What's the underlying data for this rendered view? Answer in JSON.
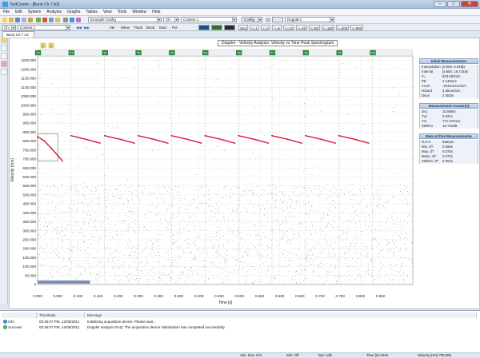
{
  "window": {
    "title": "TestCenter - [Burst Ch 7 A2]"
  },
  "menu": [
    "File",
    "Edit",
    "System",
    "Analysis",
    "Graphs",
    "Tables",
    "View",
    "Tools",
    "Window",
    "Help"
  ],
  "toolbar": {
    "config_combo": "Example Config",
    "ch_label": "Ch:",
    "context_combo": "Context 1",
    "config_btn": "Config",
    "doppler_combo": "Doppler1",
    "ch_combo2": "Ch:",
    "context_combo2": "Context 1",
    "row2_buttons": [
      "Vel",
      "Meas",
      "Track",
      "Burst",
      "Mod",
      "Pol"
    ],
    "zoom_buttons": [
      "Seq",
      "<=1",
      "<=2",
      "<=5",
      "<=10",
      "<=20",
      "<=50",
      "<=100",
      "<=200",
      "<=500"
    ]
  },
  "doc_tab": "Burst Ch 7 A2",
  "chart_data": {
    "type": "scatter",
    "title": "Doppler - Velocity Analysis: Velocity vs Time Peak Spectrogram",
    "xlabel": "Time [s]",
    "ylabel": "Velocity [m/s]",
    "xlim": [
      0.0,
      0.93
    ],
    "ylim": [
      0,
      1275
    ],
    "x_ticks": [
      "0.000",
      "0.050",
      "0.100",
      "0.150",
      "0.200",
      "0.250",
      "0.300",
      "0.350",
      "0.400",
      "0.450",
      "0.500",
      "0.550",
      "0.600",
      "0.650",
      "0.700",
      "0.750",
      "0.800",
      "0.850"
    ],
    "x_tick_values": [
      0,
      0.05,
      0.1,
      0.15,
      0.2,
      0.25,
      0.3,
      0.35,
      0.4,
      0.45,
      0.5,
      0.55,
      0.6,
      0.65,
      0.7,
      0.75,
      0.8,
      0.85
    ],
    "y_ticks": [
      "0",
      "50.000",
      "100.000",
      "150.000",
      "200.000",
      "250.000",
      "300.000",
      "350.000",
      "400.000",
      "450.000",
      "500.000",
      "550.000",
      "600.000",
      "650.000",
      "700.000",
      "750.000",
      "800.000",
      "850.000",
      "900.000",
      "950.000",
      "1000.000",
      "1050.000",
      "1100.000",
      "1150.000",
      "1200.000",
      "1250.000"
    ],
    "y_tick_values": [
      0,
      50,
      100,
      150,
      200,
      250,
      300,
      350,
      400,
      450,
      500,
      550,
      600,
      650,
      700,
      750,
      800,
      850,
      900,
      950,
      1000,
      1050,
      1100,
      1150,
      1200,
      1250
    ],
    "markers": [
      "T0",
      "T1",
      "T2",
      "T3",
      "T4",
      "T5",
      "T6",
      "T7",
      "T8",
      "T9",
      "T10"
    ],
    "marker_x": [
      0.0,
      0.083,
      0.166,
      0.249,
      0.332,
      0.415,
      0.498,
      0.581,
      0.664,
      0.747,
      0.83
    ],
    "cursors": [
      "F",
      "C"
    ],
    "grid": true,
    "bursts": [
      {
        "x": [
          0.0,
          0.017,
          0.034,
          0.05,
          0.062
        ],
        "y": [
          825,
          800,
          760,
          720,
          688
        ],
        "color": "#d81c3c"
      },
      {
        "x": [
          0.083,
          0.12,
          0.155
        ],
        "y": [
          830,
          810,
          788
        ],
        "color": "#d81c3c"
      },
      {
        "x": [
          0.166,
          0.205,
          0.24
        ],
        "y": [
          830,
          810,
          788
        ],
        "color": "#d81c3c"
      },
      {
        "x": [
          0.249,
          0.288,
          0.323
        ],
        "y": [
          830,
          810,
          788
        ],
        "color": "#d81c3c"
      },
      {
        "x": [
          0.332,
          0.371,
          0.406
        ],
        "y": [
          830,
          810,
          788
        ],
        "color": "#d81c3c"
      },
      {
        "x": [
          0.415,
          0.454,
          0.489
        ],
        "y": [
          830,
          810,
          788
        ],
        "color": "#d81c3c"
      },
      {
        "x": [
          0.498,
          0.537,
          0.572
        ],
        "y": [
          830,
          810,
          788
        ],
        "color": "#d81c3c"
      },
      {
        "x": [
          0.581,
          0.62,
          0.655
        ],
        "y": [
          830,
          810,
          788
        ],
        "color": "#d81c3c"
      },
      {
        "x": [
          0.664,
          0.703,
          0.738
        ],
        "y": [
          830,
          810,
          788
        ],
        "color": "#d81c3c"
      },
      {
        "x": [
          0.747,
          0.786,
          0.821
        ],
        "y": [
          830,
          810,
          788
        ],
        "color": "#d81c3c"
      }
    ]
  },
  "info": {
    "initial": {
      "title": "Initial Measurements",
      "rows": [
        {
          "k": "Interpolation",
          "v": "[0.000, 0.048]s"
        },
        {
          "k": "Interval",
          "v": "[4.684, 16.716]m"
        },
        {
          "k": "V₀",
          "v": "833.583m/s"
        },
        {
          "k": "PE",
          "v": "2.140m/s"
        },
        {
          "k": "Accel",
          "v": "-2818.621m/s/s"
        },
        {
          "k": "Retard",
          "v": "3.381m/s/m"
        },
        {
          "k": "Dece",
          "v": "2.483m"
        }
      ]
    },
    "cursor": {
      "title": "Measurement Cursor(s)",
      "rows": [
        {
          "k": "Dv1",
          "v": "10.590m"
        },
        {
          "k": "Tv1",
          "v": "0.021s"
        },
        {
          "k": "Vr1",
          "v": "771.072m/s"
        },
        {
          "k": "StdRv1",
          "v": "16.742dB"
        }
      ]
    },
    "rof": {
      "title": "Rate of Fire Measurements",
      "rows": [
        {
          "k": "R.O.F.",
          "v": "836rpm"
        },
        {
          "k": "Min. dT",
          "v": "0.069s"
        },
        {
          "k": "Max. dT",
          "v": "0.075s"
        },
        {
          "k": "Mean. dT",
          "v": "0.072s"
        },
        {
          "k": "StdDev. dT",
          "v": "0.002s"
        }
      ]
    }
  },
  "messages": {
    "headers": [
      "",
      "Time/Date",
      "Message"
    ],
    "rows": [
      {
        "type": "Info",
        "time": "03:45:07 PM, 12/05/2011",
        "msg": "Initializing acquisition device. Please wait..."
      },
      {
        "type": "Success",
        "time": "03:45:07 PM, 12/05/2011",
        "msg": "Doppler analysis DAQ: The acquisition device initialization has completed successfully."
      }
    ]
  },
  "status": {
    "abs_time": "Abs. time: N/A",
    "sim": "Sim: Off",
    "dyn": "Dyn: Idle",
    "time": "Time [s] 0.845",
    "velocity": "Velocity [m/s] 708.583"
  }
}
